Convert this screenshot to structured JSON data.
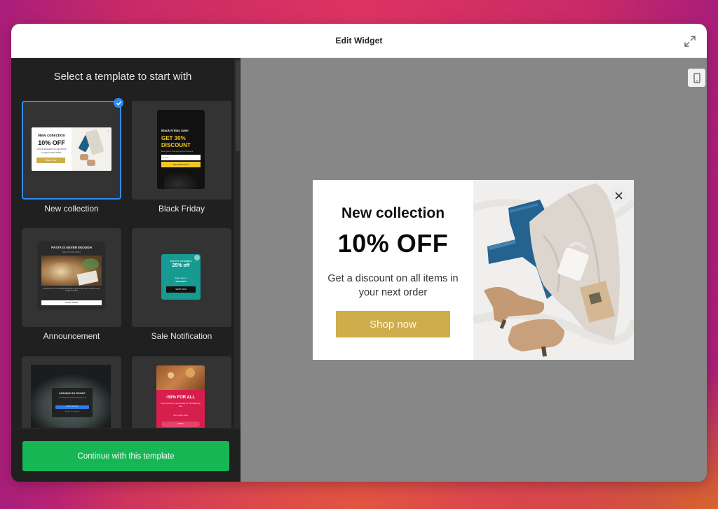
{
  "window": {
    "title": "Edit Widget",
    "expand_icon": "expand-arrows-icon"
  },
  "sidebar": {
    "heading": "Select a template to start with",
    "templates": [
      {
        "label": "New collection",
        "selected": true,
        "preview": {
          "subtitle": "New collection",
          "headline": "10% OFF",
          "body": "Get a discount on all items in your next order",
          "cta": "Shop now"
        }
      },
      {
        "label": "Black Friday",
        "selected": false,
        "preview": {
          "subtitle": "Black Friday Sale!",
          "headline_line1": "GET 30%",
          "headline_line2": "DISCOUNT",
          "body": "Enter your e-mail and get your discount",
          "input_placeholder": "E-mail",
          "cta": "GET DISCOUNT"
        }
      },
      {
        "label": "Announcement",
        "selected": false,
        "preview": {
          "headline": "PASTA IS NEVER ENOUGH",
          "subtitle": "NEW TASTING MENU",
          "body": "Pasta lovers, our new Pasta Tasting Menu gives customers the chance to try 3 different pastas",
          "cta": "LEARN MORE"
        }
      },
      {
        "label": "Sale Notification",
        "selected": false,
        "preview": {
          "subtitle": "Women's sunglasses",
          "headline": "25% off",
          "body_line1": "Sale ends on",
          "body_line2": "09/12/2020",
          "cta": "SHOP NOW"
        }
      },
      {
        "label": "",
        "selected": false,
        "preview": {
          "headline": "LEAVING SO SOON?",
          "body": "Let us tell you about our latest offer before you go",
          "cta": "GET MY DISCOUNT",
          "secondary": "No thanks, I'm not interested"
        }
      },
      {
        "label": "",
        "selected": false,
        "preview": {
          "headline": "-50% FOR ALL",
          "body": "Give presents to your family for Thanksgiving Day",
          "code_label": "Your coupon code:",
          "cta": "GET50"
        }
      }
    ],
    "continue_button": "Continue with this template"
  },
  "preview": {
    "device_toggle_icon": "mobile-phone-icon",
    "popup": {
      "subtitle": "New collection",
      "headline": "10% OFF",
      "description": "Get a discount on all items in your next order",
      "cta": "Shop now",
      "close_icon": "close-icon",
      "image": "flat-lay-clothes-jeans-sweater-boots-mug"
    }
  },
  "colors": {
    "accent_blue": "#2d8cf0",
    "continue_green": "#17b655",
    "cta_gold": "#cead4a",
    "black_friday_yellow": "#f3c623",
    "sale_teal": "#169a92",
    "thanksgiving_red": "#d61f4d"
  }
}
